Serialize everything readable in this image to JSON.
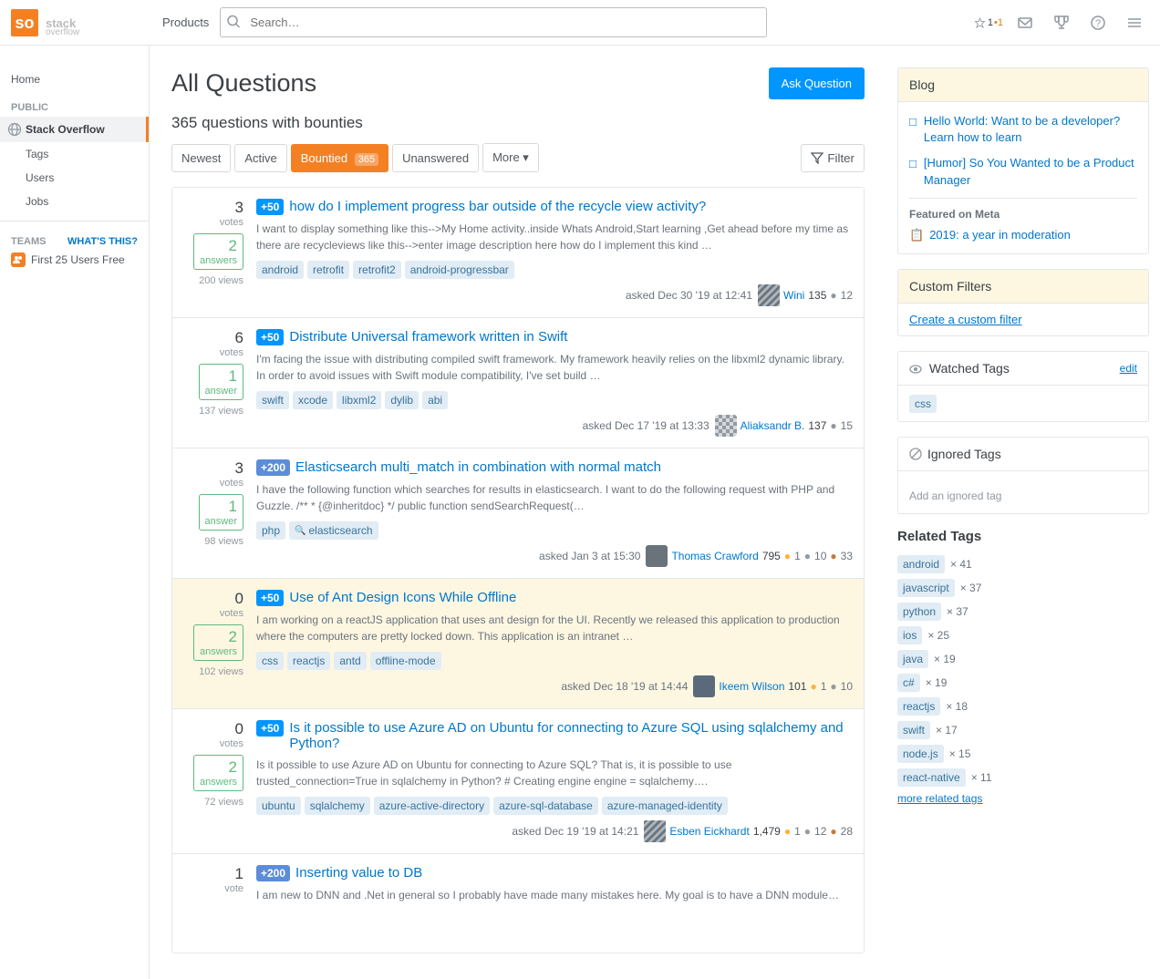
{
  "header": {
    "logo_text": "Stack Overflow",
    "products_label": "Products",
    "search_placeholder": "Search…",
    "rep_score": "1",
    "badge_count": "•1"
  },
  "sidebar": {
    "home_label": "Home",
    "public_label": "PUBLIC",
    "stackoverflow_label": "Stack Overflow",
    "tags_label": "Tags",
    "users_label": "Users",
    "jobs_label": "Jobs",
    "teams_label": "TEAMS",
    "whats_this": "What's this?",
    "first_users_label": "First 25 Users Free"
  },
  "main": {
    "page_title": "All Questions",
    "ask_button": "Ask Question",
    "questions_count": "365 questions with bounties",
    "filter_tabs": [
      {
        "label": "Newest",
        "active": false
      },
      {
        "label": "Active",
        "active": false
      },
      {
        "label": "Bountied",
        "active": true,
        "badge": "365"
      },
      {
        "label": "Unanswered",
        "active": false
      },
      {
        "label": "More ▾",
        "active": false
      }
    ],
    "filter_button": "Filter",
    "questions": [
      {
        "votes": 3,
        "answers": 2,
        "views": "200 views",
        "bounty": "+50",
        "bounty_color": "blue",
        "title": "how do I implement progress bar outside of the recycle view activity?",
        "excerpt": "I want to display something like this-->My Home activity..inside Whats Android,Start learning ,Get ahead before my time as there are recycleviews like this-->enter image description here how do I implement this kind …",
        "tags": [
          "android",
          "retrofit",
          "retrofit2",
          "android-progressbar"
        ],
        "asked_text": "asked Dec 30 '19 at 12:41",
        "user_name": "Wini",
        "user_rep": "135",
        "user_gold": "",
        "user_silver": "●",
        "user_silver_count": "12",
        "user_bronze": "",
        "highlighted": false
      },
      {
        "votes": 6,
        "answers": 1,
        "answers_label": "answer",
        "views": "137 views",
        "bounty": "+50",
        "bounty_color": "blue",
        "title": "Distribute Universal framework written in Swift",
        "excerpt": "I'm facing the issue with distributing compiled swift framework. My framework heavily relies on the libxml2 dynamic library. In order to avoid issues with Swift module compatibility, I've set build …",
        "tags": [
          "swift",
          "xcode",
          "libxml2",
          "dylib",
          "abi"
        ],
        "asked_text": "asked Dec 17 '19 at 13:33",
        "user_name": "Aliaksandr B.",
        "user_rep": "137",
        "user_silver": "●",
        "user_silver_count": "15",
        "highlighted": false
      },
      {
        "votes": 3,
        "answers": 1,
        "answers_label": "answer",
        "views": "98 views",
        "bounty": "+200",
        "bounty_color": "blue",
        "title": "Elasticsearch multi_match in combination with normal match",
        "excerpt": "I have the following function which searches for results in elasticsearch. I want to do the following request with PHP and Guzzle. /** * {@inheritdoc} */ public function sendSearchRequest(…",
        "tags": [
          "php",
          "elasticsearch"
        ],
        "tag_elasticsearch_icon": true,
        "asked_text": "asked Jan 3 at 15:30",
        "user_name": "Thomas Crawford",
        "user_rep": "795",
        "user_gold": "●",
        "user_gold_count": "1",
        "user_silver": "●",
        "user_silver_count": "10",
        "user_bronze": "●",
        "user_bronze_count": "33",
        "highlighted": false
      },
      {
        "votes": 0,
        "answers": 2,
        "views": "102 views",
        "bounty": "+50",
        "bounty_color": "blue",
        "title": "Use of Ant Design Icons While Offline",
        "excerpt": "I am working on a reactJS application that uses ant design for the UI. Recently we released this application to production where the computers are pretty locked down. This application is an intranet …",
        "tags": [
          "css",
          "reactjs",
          "antd",
          "offline-mode"
        ],
        "asked_text": "asked Dec 18 '19 at 14:44",
        "user_name": "Ikeem Wilson",
        "user_rep": "101",
        "user_gold": "●",
        "user_gold_count": "1",
        "user_silver": "●",
        "user_silver_count": "10",
        "highlighted": true
      },
      {
        "votes": 0,
        "answers": 2,
        "views": "72 views",
        "bounty": "+50",
        "bounty_color": "blue",
        "title": "Is it possible to use Azure AD on Ubuntu for connecting to Azure SQL using sqlalchemy and Python?",
        "excerpt": "Is it possible to use Azure AD on Ubuntu for connecting to Azure SQL? That is, it is possible to use trusted_connection=True in sqlalchemy in Python? # Creating engine engine = sqlalchemy….",
        "tags": [
          "ubuntu",
          "sqlalchemy",
          "azure-active-directory",
          "azure-sql-database",
          "azure-managed-identity"
        ],
        "asked_text": "asked Dec 19 '19 at 14:21",
        "user_name": "Esben Eickhardt",
        "user_rep": "1,479",
        "user_gold": "●",
        "user_gold_count": "1",
        "user_silver": "●",
        "user_silver_count": "12",
        "user_bronze": "●",
        "user_bronze_count": "28",
        "highlighted": false
      },
      {
        "votes": 1,
        "answers": 0,
        "views": "",
        "bounty": "+200",
        "bounty_color": "blue",
        "title": "Inserting value to DB",
        "excerpt": "I am new to DNN and .Net in general so I probably have made many mistakes here. My goal is to have a DNN module…",
        "tags": [],
        "asked_text": "",
        "user_name": "",
        "user_rep": "",
        "highlighted": false
      }
    ]
  },
  "right_sidebar": {
    "blog_title": "Blog",
    "blog_links": [
      {
        "text": "Hello World: Want to be a developer? Learn how to learn"
      },
      {
        "text": "[Humor] So You Wanted to be a Product Manager"
      }
    ],
    "featured_label": "Featured on Meta",
    "featured_links": [
      {
        "text": "2019: a year in moderation"
      }
    ],
    "custom_filters_title": "Custom Filters",
    "create_filter_label": "Create a custom filter",
    "watched_tags_title": "Watched Tags",
    "edit_label": "edit",
    "watched_tags": [
      "css"
    ],
    "ignored_tags_title": "Ignored Tags",
    "add_ignored_label": "Add an ignored tag",
    "related_tags_title": "Related Tags",
    "related_tags": [
      {
        "tag": "android",
        "count": "× 41"
      },
      {
        "tag": "javascript",
        "count": "× 37"
      },
      {
        "tag": "python",
        "count": "× 37"
      },
      {
        "tag": "ios",
        "count": "× 25"
      },
      {
        "tag": "java",
        "count": "× 19"
      },
      {
        "tag": "c#",
        "count": "× 19"
      },
      {
        "tag": "reactjs",
        "count": "× 18"
      },
      {
        "tag": "swift",
        "count": "× 17"
      },
      {
        "tag": "node.js",
        "count": "× 15"
      },
      {
        "tag": "react-native",
        "count": "× 11"
      }
    ],
    "more_related_label": "more related tags"
  }
}
